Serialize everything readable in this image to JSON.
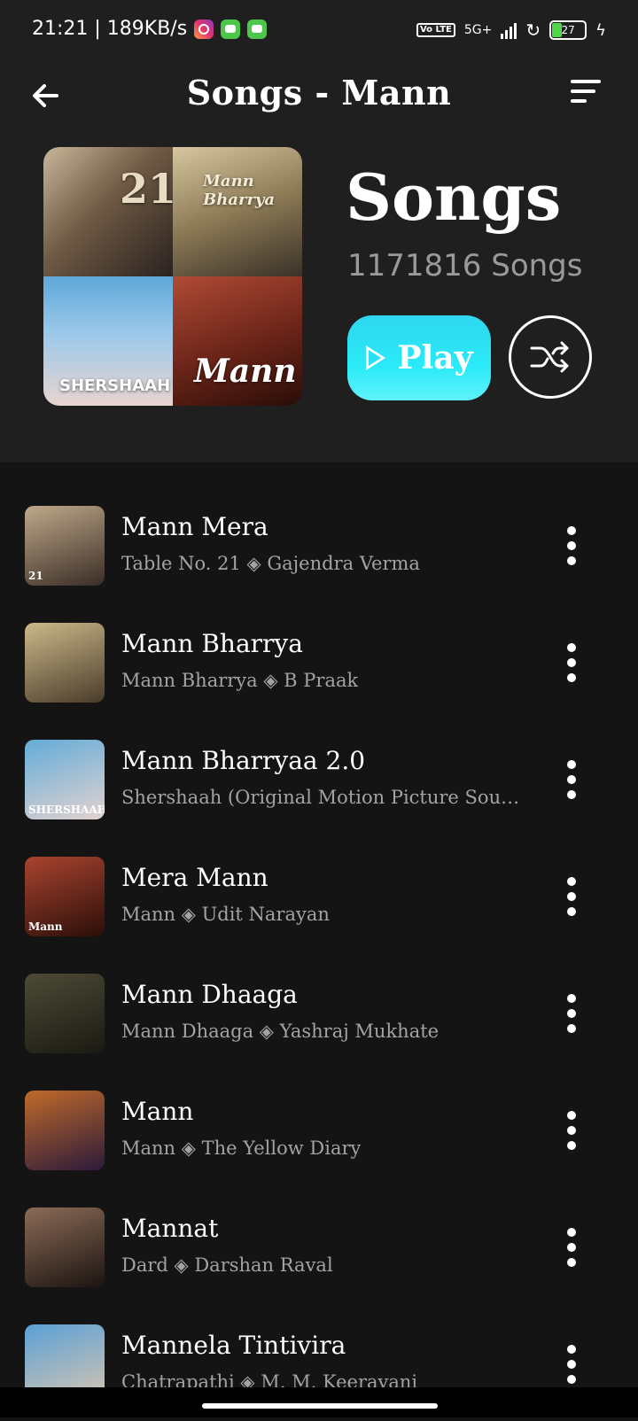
{
  "status_bar": {
    "time_speed": "21:21 | 189KB/s",
    "network": "5G+",
    "volte": "Vo LTE",
    "battery": "27"
  },
  "header": {
    "title": "Songs - Mann"
  },
  "playlist": {
    "title": "Songs",
    "count": "1171816 Songs",
    "play_label": "Play",
    "cover_texts": [
      "21",
      "Mann Bharrya",
      "SHERSHAAH",
      "Mann"
    ]
  },
  "songs": [
    {
      "title": "Mann Mera",
      "subtitle": "Table No. 21 ◈ Gajendra Verma",
      "thumb_label": "21",
      "colors": [
        "#bfa98a",
        "#3a2d26"
      ]
    },
    {
      "title": "Mann Bharrya",
      "subtitle": "Mann Bharrya ◈ B Praak",
      "thumb_label": "",
      "colors": [
        "#cbb989",
        "#4a3c2b"
      ]
    },
    {
      "title": "Mann Bharryaa 2.0",
      "subtitle": "Shershaah (Original Motion Picture Soundtr...",
      "thumb_label": "SHERSHAAH",
      "colors": [
        "#63acd9",
        "#e2d2cf"
      ]
    },
    {
      "title": "Mera Mann",
      "subtitle": "Mann ◈ Udit Narayan",
      "thumb_label": "Mann",
      "colors": [
        "#a9442f",
        "#2b0e09"
      ]
    },
    {
      "title": "Mann Dhaaga",
      "subtitle": "Mann Dhaaga ◈ Yashraj Mukhate",
      "thumb_label": "",
      "colors": [
        "#4d4a36",
        "#1b1a12"
      ]
    },
    {
      "title": "Mann",
      "subtitle": "Mann ◈ The Yellow Diary",
      "thumb_label": "",
      "colors": [
        "#c06a2a",
        "#2c1a3a"
      ]
    },
    {
      "title": "Mannat",
      "subtitle": "Dard ◈ Darshan Raval",
      "thumb_label": "",
      "colors": [
        "#8b6b58",
        "#1c1410"
      ]
    },
    {
      "title": "Mannela Tintivira",
      "subtitle": "Chatrapathi ◈ M. M. Keeravani",
      "thumb_label": "",
      "colors": [
        "#5aa0d6",
        "#d9c6b0"
      ]
    }
  ]
}
